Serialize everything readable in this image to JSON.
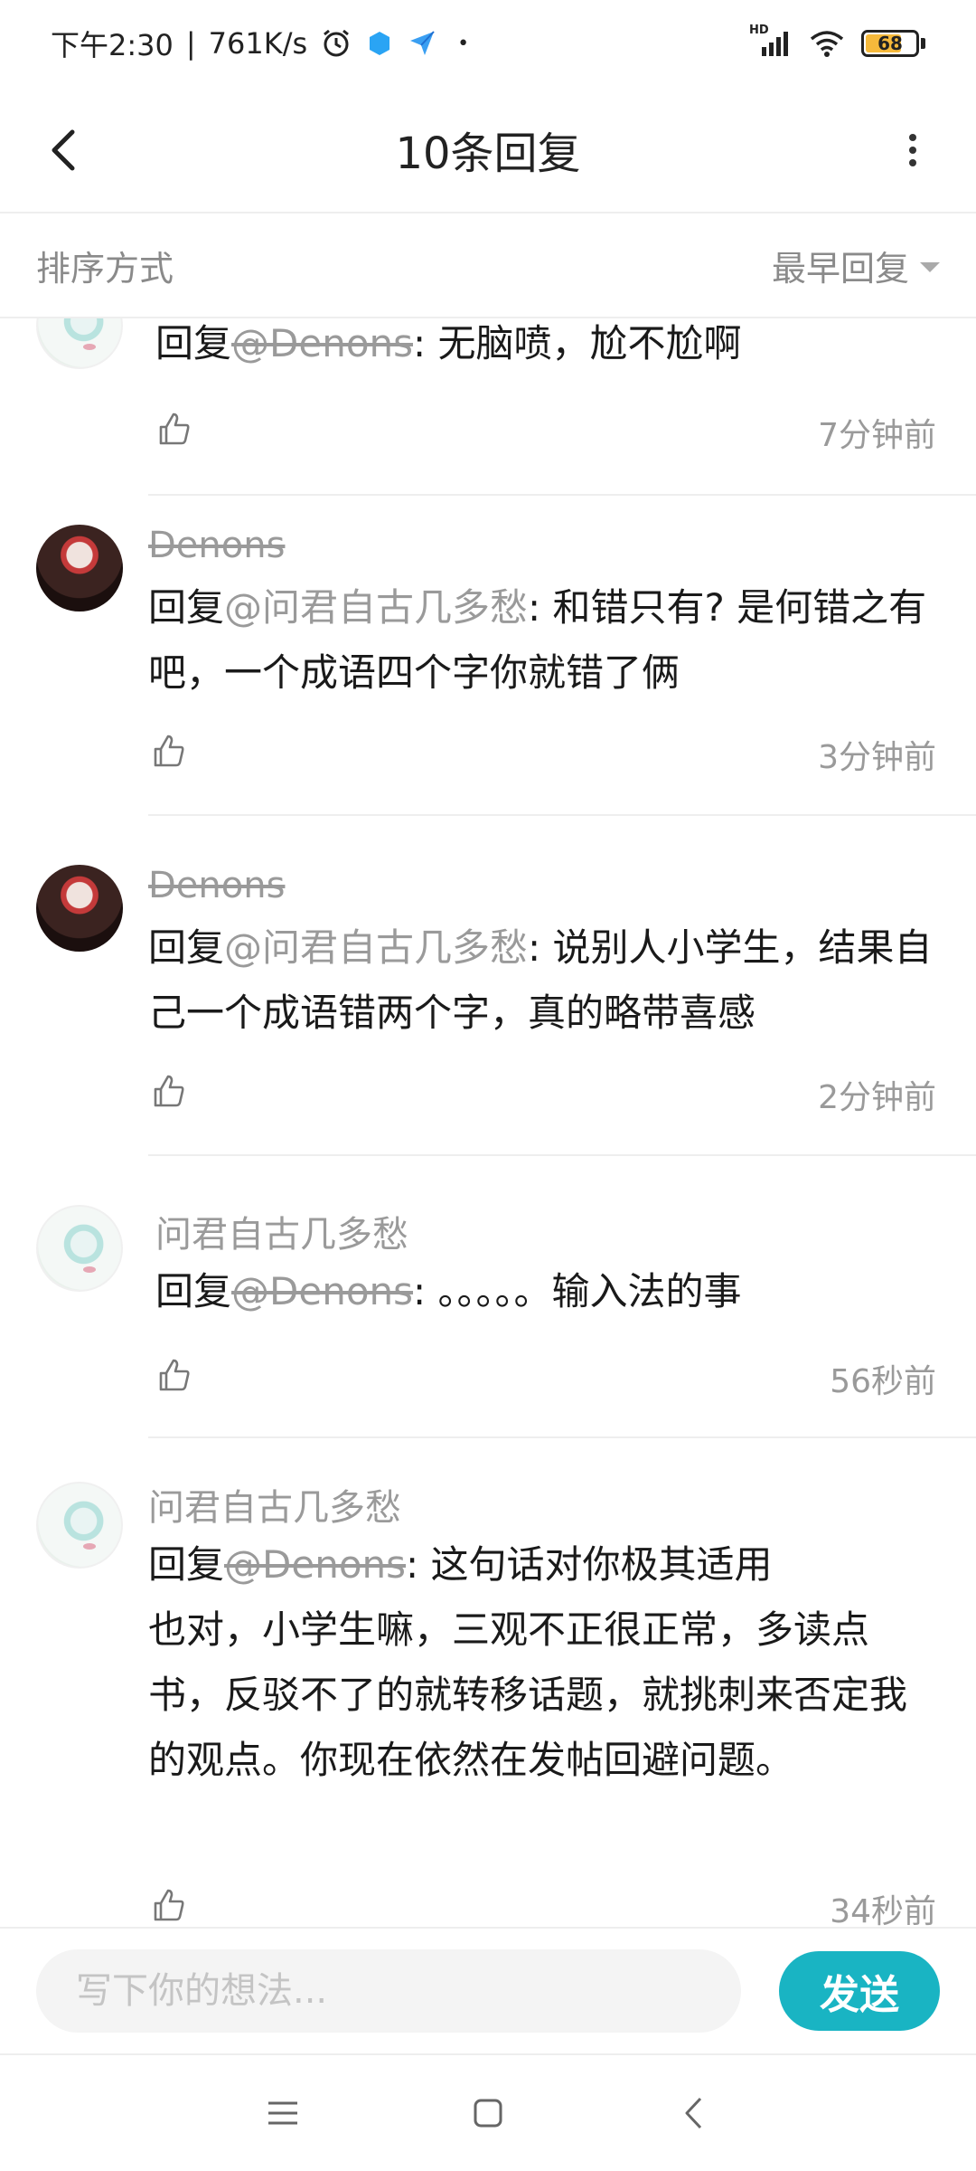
{
  "status_bar": {
    "time": "下午2:30",
    "net_speed": "761K/s",
    "separator": "|",
    "dot": "•",
    "hd_label": "HD",
    "battery": "68"
  },
  "header": {
    "title": "10条回复"
  },
  "sort": {
    "label": "排序方式",
    "value": "最早回复"
  },
  "replies": [
    {
      "username": "",
      "prefix": "回复",
      "mention": "@Denons",
      "text": ": 无脑喷，尬不尬啊",
      "time": "7分钟前"
    },
    {
      "username": "Denons",
      "prefix": "回复",
      "mention": "@问君自古几多愁",
      "text": ": 和错只有? 是何错之有吧，一个成语四个字你就错了俩",
      "time": "3分钟前"
    },
    {
      "username": "Denons",
      "prefix": "回复",
      "mention": "@问君自古几多愁",
      "text": ": 说别人小学生，结果自己一个成语错两个字，真的略带喜感",
      "time": "2分钟前"
    },
    {
      "username": "问君自古几多愁",
      "prefix": "回复",
      "mention": "@Denons",
      "text": ": 。。。。。输入法的事",
      "time": "56秒前"
    },
    {
      "username": "问君自古几多愁",
      "prefix": "回复",
      "mention": "@Denons",
      "text": ": 这句话对你极其适用",
      "text2": "也对，小学生嘛，三观不正很正常，多读点书，反驳不了的就转移话题，就挑刺来否定我的观点。你现在依然在发帖回避问题。",
      "time": "34秒前"
    }
  ],
  "input": {
    "placeholder": "写下你的想法...",
    "value": ""
  },
  "send_label": "发送",
  "colors": {
    "accent": "#19b4c3",
    "muted": "#9a9a9a",
    "battery": "#f6b93b"
  },
  "icons": [
    "alarm-icon",
    "app-icon",
    "feishu-icon",
    "signal-icon",
    "wifi-icon",
    "battery-icon",
    "back-icon",
    "more-icon",
    "sort-caret-icon",
    "thumb-up-icon",
    "menu-icon",
    "home-icon",
    "nav-back-icon"
  ]
}
